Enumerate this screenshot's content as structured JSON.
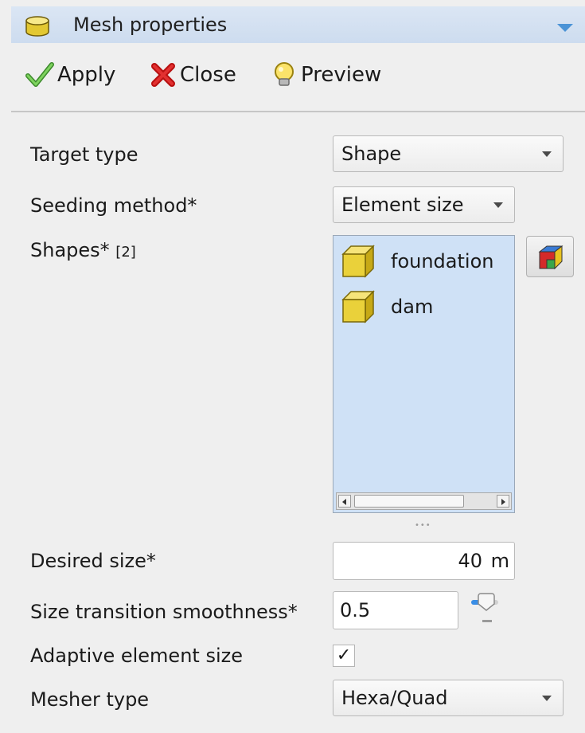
{
  "panel": {
    "title": "Mesh properties"
  },
  "toolbar": {
    "apply_label": "Apply",
    "close_label": "Close",
    "preview_label": "Preview"
  },
  "form": {
    "target_type": {
      "label": "Target type",
      "value": "Shape"
    },
    "seeding_method": {
      "label": "Seeding method*",
      "value": "Element size"
    },
    "shapes": {
      "label": "Shapes*",
      "count": "[2]",
      "items": [
        {
          "name": "foundation"
        },
        {
          "name": "dam"
        }
      ]
    },
    "desired_size": {
      "label": "Desired size*",
      "value": "40",
      "unit": "m"
    },
    "smoothness": {
      "label": "Size transition smoothness*",
      "value": "0.5"
    },
    "adaptive": {
      "label": "Adaptive element size",
      "checked": true,
      "mark": "✓"
    },
    "mesher_type": {
      "label": "Mesher type",
      "value": "Hexa/Quad"
    }
  },
  "colors": {
    "header_bg": "#d4e1f2",
    "list_bg": "#cfe1f6",
    "panel_bg": "#efefef",
    "shape_icon": "#e8cf3a"
  },
  "icons": [
    "mesh-cylinder-icon",
    "collapse-triangle-icon",
    "check-icon",
    "red-x-icon",
    "lightbulb-icon",
    "cube-icon",
    "color-cube-icon",
    "slider-icon"
  ]
}
